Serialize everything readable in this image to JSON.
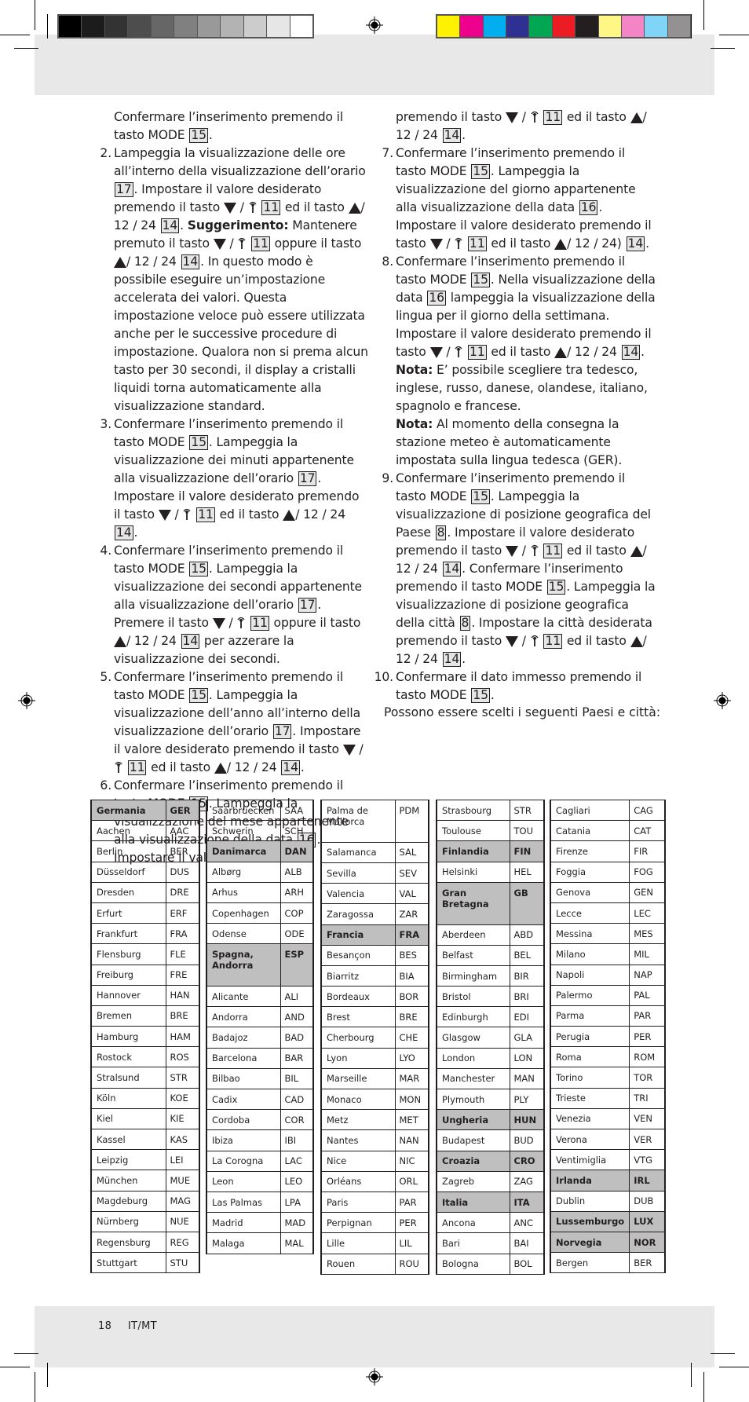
{
  "print_marks": {
    "gray_swatches": [
      "#000000",
      "#1c1c1c",
      "#333333",
      "#4d4d4d",
      "#666666",
      "#808080",
      "#999999",
      "#b3b3b3",
      "#cccccc",
      "#e6e6e6",
      "#ffffff"
    ],
    "color_swatches": [
      "#fff200",
      "#ec008c",
      "#00aeef",
      "#2e3192",
      "#00a651",
      "#ed1c24",
      "#231f20",
      "#fff685",
      "#f384c6",
      "#7fd4f7",
      "#939191"
    ]
  },
  "symbols": {
    "down": "▼",
    "antenna": "⸆",
    "up": "▲",
    "slash": "/",
    "mode": "MODE"
  },
  "instructions": {
    "left_column": [
      {
        "num": "",
        "parts": [
          {
            "t": "Confermare l’inserimento premendo il tasto MODE "
          },
          {
            "box": "15"
          },
          {
            "t": "."
          }
        ]
      },
      {
        "num": "2.",
        "parts": [
          {
            "t": "Lampeggia la visualizzazione delle ore all’interno della visualizzazione dell’orario "
          },
          {
            "box": "17"
          },
          {
            "t": ". Impostare il valore desiderato premendo il tasto "
          },
          {
            "icon": "down-antenna"
          },
          {
            "t": " "
          },
          {
            "box": "11"
          },
          {
            "t": " ed il tasto "
          },
          {
            "icon": "up-1224"
          },
          {
            "t": " "
          },
          {
            "box": "14"
          },
          {
            "t": ". "
          },
          {
            "b": "Suggerimento:"
          },
          {
            "t": " Mantenere premuto il tasto "
          },
          {
            "icon": "down-antenna"
          },
          {
            "t": " "
          },
          {
            "box": "11"
          },
          {
            "t": " oppure il tasto "
          },
          {
            "icon": "up-1224"
          },
          {
            "t": " "
          },
          {
            "box": "14"
          },
          {
            "t": ". In questo modo è possibile eseguire un’impostazione accelerata dei valori. Questa impostazione veloce può essere utilizzata anche per le successive procedure di impostazione. Qualora non si prema alcun tasto per 30 secondi, il display a cristalli liquidi torna automaticamente alla visualizzazione standard."
          }
        ]
      },
      {
        "num": "3.",
        "parts": [
          {
            "t": "Confermare l’inserimento premendo il tasto MODE "
          },
          {
            "box": "15"
          },
          {
            "t": ". Lampeggia la visualizzazione dei minuti appartenente alla visualizzazione dell’orario "
          },
          {
            "box": "17"
          },
          {
            "t": ". Impostare il valore desiderato premendo il tasto "
          },
          {
            "icon": "down-antenna"
          },
          {
            "t": " "
          },
          {
            "box": "11"
          },
          {
            "t": " ed il tasto "
          },
          {
            "icon": "up-1224"
          },
          {
            "t": " "
          },
          {
            "box": "14"
          },
          {
            "t": "."
          }
        ]
      },
      {
        "num": "4.",
        "parts": [
          {
            "t": "Confermare l’inserimento premendo il tasto MODE "
          },
          {
            "box": "15"
          },
          {
            "t": ". Lampeggia la visualizzazione dei secondi appartenente alla visualizzazione dell’orario "
          },
          {
            "box": "17"
          },
          {
            "t": ". Premere il tasto "
          },
          {
            "icon": "down-antenna"
          },
          {
            "t": " "
          },
          {
            "box": "11"
          },
          {
            "t": " oppure il tasto "
          },
          {
            "icon": "up-1224"
          },
          {
            "t": " "
          },
          {
            "box": "14"
          },
          {
            "t": " per azzerare la visualizzazione dei secondi."
          }
        ]
      },
      {
        "num": "5.",
        "parts": [
          {
            "t": "Confermare l’inserimento premendo il tasto MODE "
          },
          {
            "box": "15"
          },
          {
            "t": ". Lampeggia la visualizzazione dell’anno all’interno della visualizzazione dell’orario "
          },
          {
            "box": "17"
          },
          {
            "t": ". Impostare il valore desiderato premendo il tasto "
          },
          {
            "icon": "down-antenna"
          },
          {
            "t": " "
          },
          {
            "box": "11"
          },
          {
            "t": " ed il tasto "
          },
          {
            "icon": "up-1224"
          },
          {
            "t": " "
          },
          {
            "box": "14"
          },
          {
            "t": "."
          }
        ]
      },
      {
        "num": "6.",
        "parts": [
          {
            "t": "Confermare l’inserimento premendo il tasto MODE "
          },
          {
            "box": "15"
          },
          {
            "t": ". Lampeggia la visualizzazione del mese appartenente alla visualizzazione della data "
          },
          {
            "box": "16"
          },
          {
            "t": ". Impostare il valore desiderato"
          }
        ]
      }
    ],
    "right_column": [
      {
        "num": "",
        "parts": [
          {
            "t": "premendo il tasto "
          },
          {
            "icon": "down-antenna"
          },
          {
            "t": " "
          },
          {
            "box": "11"
          },
          {
            "t": " ed il tasto "
          },
          {
            "icon": "up-1224"
          },
          {
            "t": " "
          },
          {
            "box": "14"
          },
          {
            "t": "."
          }
        ]
      },
      {
        "num": "7.",
        "parts": [
          {
            "t": "Confermare l’inserimento premendo il tasto MODE "
          },
          {
            "box": "15"
          },
          {
            "t": ". Lampeggia la visualizzazione del giorno appartenente alla visualizzazione della data "
          },
          {
            "box": "16"
          },
          {
            "t": ". Impostare il valore desiderato premendo il tasto "
          },
          {
            "icon": "down-antenna"
          },
          {
            "t": " "
          },
          {
            "box": "11"
          },
          {
            "t": " ed il tasto "
          },
          {
            "icon": "up-1224-paren"
          },
          {
            "t": " "
          },
          {
            "box": "14"
          },
          {
            "t": "."
          }
        ]
      },
      {
        "num": "8.",
        "parts": [
          {
            "t": "Confermare l’inserimento premendo il tasto MODE "
          },
          {
            "box": "15"
          },
          {
            "t": ". Nella visualizzazione della data "
          },
          {
            "box": "16"
          },
          {
            "t": " lampeggia la visualizzazione della lingua per il giorno della settimana. Impostare il valore desiderato premendo il tasto "
          },
          {
            "icon": "down-antenna"
          },
          {
            "t": " "
          },
          {
            "box": "11"
          },
          {
            "t": " ed il tasto "
          },
          {
            "icon": "up-1224"
          },
          {
            "t": " "
          },
          {
            "box": "14"
          },
          {
            "t": "."
          },
          {
            "br": true
          },
          {
            "b": "Nota:"
          },
          {
            "t": " E’ possibile scegliere tra tedesco, inglese, russo, danese, olandese, italiano, spagnolo e francese."
          },
          {
            "br": true
          },
          {
            "b": "Nota:"
          },
          {
            "t": " Al momento della consegna la stazione meteo è automaticamente impostata sulla lingua tedesca (GER)."
          }
        ]
      },
      {
        "num": "9.",
        "parts": [
          {
            "t": "Confermare l’inserimento premendo il tasto MODE "
          },
          {
            "box": "15"
          },
          {
            "t": ". Lampeggia la visualizzazione di posizione geografica del Paese "
          },
          {
            "box": " 8 "
          },
          {
            "t": ". Impostare il valore desiderato premendo il tasto "
          },
          {
            "icon": "down-antenna"
          },
          {
            "t": " "
          },
          {
            "box": "11"
          },
          {
            "t": " ed il tasto "
          },
          {
            "icon": "up-1224"
          },
          {
            "t": " "
          },
          {
            "box": "14"
          },
          {
            "t": ". Confermare l’inserimento premendo il tasto MODE "
          },
          {
            "box": "15"
          },
          {
            "t": ". Lampeggia la visualizzazione di posizione geografica della città "
          },
          {
            "box": " 8 "
          },
          {
            "t": ". Impostare la città desiderata premendo il tasto "
          },
          {
            "icon": "down-antenna"
          },
          {
            "t": " "
          },
          {
            "box": "11"
          },
          {
            "t": " ed il tasto "
          },
          {
            "icon": "up-1224"
          },
          {
            "t": " "
          },
          {
            "box": "14"
          },
          {
            "t": "."
          }
        ]
      },
      {
        "num": "10.",
        "parts": [
          {
            "t": "Confermare il dato immesso premendo il tasto MODE "
          },
          {
            "box": "15"
          },
          {
            "t": "."
          }
        ]
      }
    ]
  },
  "intro_text": "Possono essere scelti i seguenti Paesi e città:",
  "city_tables": [
    [
      {
        "name": "Germania",
        "code": "GER",
        "country": true
      },
      {
        "name": "Aachen",
        "code": "AAC"
      },
      {
        "name": "Berlin",
        "code": "BER"
      },
      {
        "name": "Düsseldorf",
        "code": "DUS"
      },
      {
        "name": "Dresden",
        "code": "DRE"
      },
      {
        "name": "Erfurt",
        "code": "ERF"
      },
      {
        "name": "Frankfurt",
        "code": "FRA"
      },
      {
        "name": "Flensburg",
        "code": "FLE"
      },
      {
        "name": "Freiburg",
        "code": "FRE"
      },
      {
        "name": "Hannover",
        "code": "HAN"
      },
      {
        "name": "Bremen",
        "code": "BRE"
      },
      {
        "name": "Hamburg",
        "code": "HAM"
      },
      {
        "name": "Rostock",
        "code": "ROS"
      },
      {
        "name": "Stralsund",
        "code": "STR"
      },
      {
        "name": "Köln",
        "code": "KOE"
      },
      {
        "name": "Kiel",
        "code": "KIE"
      },
      {
        "name": "Kassel",
        "code": "KAS"
      },
      {
        "name": "Leipzig",
        "code": "LEI"
      },
      {
        "name": "München",
        "code": "MUE"
      },
      {
        "name": "Magdeburg",
        "code": "MAG"
      },
      {
        "name": "Nürnberg",
        "code": "NUE"
      },
      {
        "name": "Regensburg",
        "code": "REG"
      },
      {
        "name": "Stuttgart",
        "code": "STU"
      }
    ],
    [
      {
        "name": "Saarbruecken",
        "code": "SAA"
      },
      {
        "name": "Schwerin",
        "code": "SCH"
      },
      {
        "name": "Danimarca",
        "code": "DAN",
        "country": true
      },
      {
        "name": "Albørg",
        "code": "ALB"
      },
      {
        "name": "Arhus",
        "code": "ARH"
      },
      {
        "name": "Copenhagen",
        "code": "COP"
      },
      {
        "name": "Odense",
        "code": "ODE"
      },
      {
        "name": "Spagna, Andorra",
        "code": "ESP",
        "country": true,
        "tall": true
      },
      {
        "name": "Alicante",
        "code": "ALI"
      },
      {
        "name": "Andorra",
        "code": "AND"
      },
      {
        "name": "Badajoz",
        "code": "BAD"
      },
      {
        "name": "Barcelona",
        "code": "BAR"
      },
      {
        "name": "Bilbao",
        "code": "BIL"
      },
      {
        "name": "Cadix",
        "code": "CAD"
      },
      {
        "name": "Cordoba",
        "code": "COR"
      },
      {
        "name": "Ibiza",
        "code": "IBI"
      },
      {
        "name": "La Corogna",
        "code": "LAC"
      },
      {
        "name": "Leon",
        "code": "LEO"
      },
      {
        "name": "Las Palmas",
        "code": "LPA"
      },
      {
        "name": "Madrid",
        "code": "MAD"
      },
      {
        "name": "Malaga",
        "code": "MAL"
      }
    ],
    [
      {
        "name": "Palma de Mallorca",
        "code": "PDM",
        "tall": true
      },
      {
        "name": "Salamanca",
        "code": "SAL"
      },
      {
        "name": "Sevilla",
        "code": "SEV"
      },
      {
        "name": "Valencia",
        "code": "VAL"
      },
      {
        "name": "Zaragossa",
        "code": "ZAR"
      },
      {
        "name": "Francia",
        "code": "FRA",
        "country": true
      },
      {
        "name": "Besançon",
        "code": "BES"
      },
      {
        "name": "Biarritz",
        "code": "BIA"
      },
      {
        "name": "Bordeaux",
        "code": "BOR"
      },
      {
        "name": "Brest",
        "code": "BRE"
      },
      {
        "name": "Cherbourg",
        "code": "CHE"
      },
      {
        "name": "Lyon",
        "code": "LYO"
      },
      {
        "name": "Marseille",
        "code": "MAR"
      },
      {
        "name": "Monaco",
        "code": "MON"
      },
      {
        "name": "Metz",
        "code": "MET"
      },
      {
        "name": "Nantes",
        "code": "NAN"
      },
      {
        "name": "Nice",
        "code": "NIC"
      },
      {
        "name": "Orléans",
        "code": "ORL"
      },
      {
        "name": "Paris",
        "code": "PAR"
      },
      {
        "name": "Perpignan",
        "code": "PER"
      },
      {
        "name": "Lille",
        "code": "LIL"
      },
      {
        "name": "Rouen",
        "code": "ROU"
      }
    ],
    [
      {
        "name": "Strasbourg",
        "code": "STR"
      },
      {
        "name": "Toulouse",
        "code": "TOU"
      },
      {
        "name": "Finlandia",
        "code": "FIN",
        "country": true
      },
      {
        "name": "Helsinki",
        "code": "HEL"
      },
      {
        "name": "Gran Bretagna",
        "code": "GB",
        "country": true,
        "tall": true
      },
      {
        "name": "Aberdeen",
        "code": "ABD"
      },
      {
        "name": "Belfast",
        "code": "BEL"
      },
      {
        "name": "Birmingham",
        "code": "BIR"
      },
      {
        "name": "Bristol",
        "code": "BRI"
      },
      {
        "name": "Edinburgh",
        "code": "EDI"
      },
      {
        "name": "Glasgow",
        "code": "GLA"
      },
      {
        "name": "London",
        "code": "LON"
      },
      {
        "name": "Manchester",
        "code": "MAN"
      },
      {
        "name": "Plymouth",
        "code": "PLY"
      },
      {
        "name": "Ungheria",
        "code": "HUN",
        "country": true
      },
      {
        "name": "Budapest",
        "code": "BUD"
      },
      {
        "name": "Croazia",
        "code": "CRO",
        "country": true
      },
      {
        "name": "Zagreb",
        "code": "ZAG"
      },
      {
        "name": "Italia",
        "code": "ITA",
        "country": true
      },
      {
        "name": "Ancona",
        "code": "ANC"
      },
      {
        "name": "Bari",
        "code": "BAI"
      },
      {
        "name": "Bologna",
        "code": "BOL"
      }
    ],
    [
      {
        "name": "Cagliari",
        "code": "CAG"
      },
      {
        "name": "Catania",
        "code": "CAT"
      },
      {
        "name": "Firenze",
        "code": "FIR"
      },
      {
        "name": "Foggia",
        "code": "FOG"
      },
      {
        "name": "Genova",
        "code": "GEN"
      },
      {
        "name": "Lecce",
        "code": "LEC"
      },
      {
        "name": "Messina",
        "code": "MES"
      },
      {
        "name": "Milano",
        "code": "MIL"
      },
      {
        "name": "Napoli",
        "code": "NAP"
      },
      {
        "name": "Palermo",
        "code": "PAL"
      },
      {
        "name": "Parma",
        "code": "PAR"
      },
      {
        "name": "Perugia",
        "code": "PER"
      },
      {
        "name": "Roma",
        "code": "ROM"
      },
      {
        "name": "Torino",
        "code": "TOR"
      },
      {
        "name": "Trieste",
        "code": "TRI"
      },
      {
        "name": "Venezia",
        "code": "VEN"
      },
      {
        "name": "Verona",
        "code": "VER"
      },
      {
        "name": "Ventimiglia",
        "code": "VTG"
      },
      {
        "name": "Irlanda",
        "code": "IRL",
        "country": true
      },
      {
        "name": "Dublin",
        "code": "DUB"
      },
      {
        "name": "Lussemburgo",
        "code": "LUX",
        "country": true
      },
      {
        "name": "Norvegia",
        "code": "NOR",
        "country": true
      },
      {
        "name": "Bergen",
        "code": "BER"
      }
    ]
  ],
  "footer": {
    "page_number": "18",
    "locale": "IT/MT"
  }
}
